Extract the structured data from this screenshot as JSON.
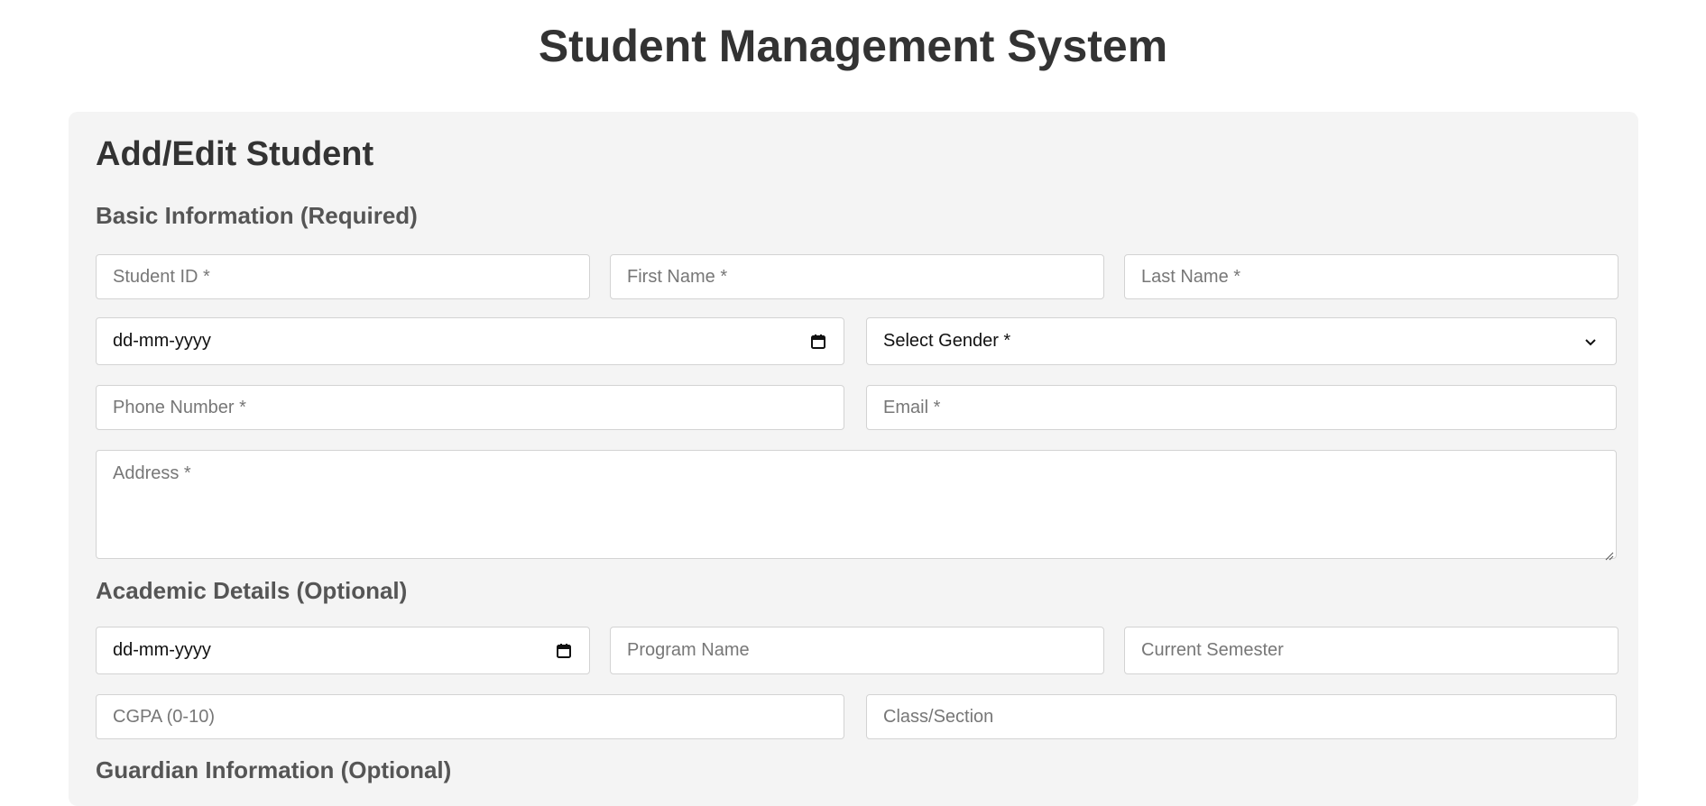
{
  "page": {
    "title": "Student Management System"
  },
  "form": {
    "title": "Add/Edit Student",
    "sections": {
      "basic": {
        "title": "Basic Information (Required)",
        "student_id_placeholder": "Student ID *",
        "first_name_placeholder": "First Name *",
        "last_name_placeholder": "Last Name *",
        "dob_value": "dd-mm-yyyy",
        "gender_selected": "Select Gender *",
        "phone_placeholder": "Phone Number *",
        "email_placeholder": "Email *",
        "address_placeholder": "Address *"
      },
      "academic": {
        "title": "Academic Details (Optional)",
        "admission_date_value": "dd-mm-yyyy",
        "program_placeholder": "Program Name",
        "semester_placeholder": "Current Semester",
        "cgpa_placeholder": "CGPA (0-10)",
        "class_placeholder": "Class/Section"
      },
      "guardian": {
        "title": "Guardian Information (Optional)"
      }
    }
  },
  "icons": {
    "calendar": "calendar-icon",
    "chevron": "chevron-down-icon",
    "resize": "resize-grip-icon"
  }
}
